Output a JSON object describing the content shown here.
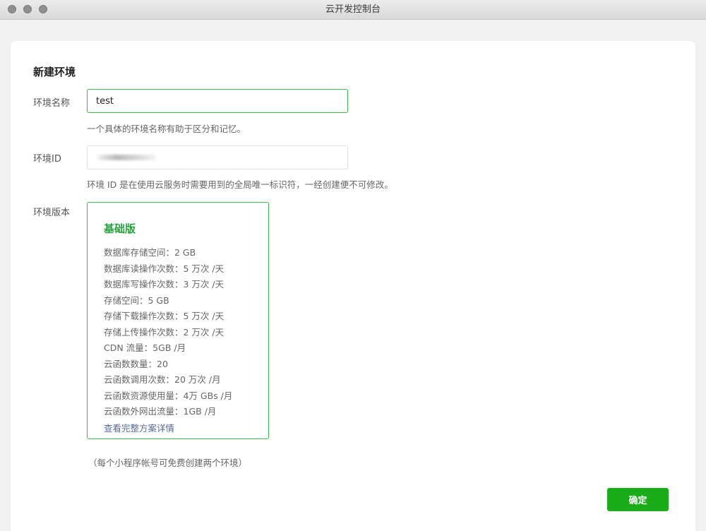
{
  "window": {
    "title": "云开发控制台"
  },
  "form": {
    "heading": "新建环境",
    "env_name": {
      "label": "环境名称",
      "value": "test",
      "hint": "一个具体的环境名称有助于区分和记忆。"
    },
    "env_id": {
      "label": "环境ID",
      "value": "",
      "hint": "环境 ID 是在使用云服务时需要用到的全局唯一标识符，一经创建便不可修改。"
    },
    "env_version": {
      "label": "环境版本",
      "plan": {
        "name": "基础版",
        "features": [
          "数据库存储空间：2 GB",
          "数据库读操作次数：5 万次 /天",
          "数据库写操作次数：3 万次 /天",
          "存储空间：5 GB",
          "存储下载操作次数：5 万次 /天",
          "存储上传操作次数：2 万次 /天",
          "CDN 流量：5GB /月",
          "云函数数量：20",
          "云函数调用次数：20 万次 /月",
          "云函数资源使用量：4万 GBs /月",
          "云函数外网出流量：1GB /月"
        ],
        "details_link": "查看完整方案详情"
      }
    },
    "note": "（每个小程序帐号可免费创建两个环境）",
    "confirm_label": "确定"
  },
  "colors": {
    "accent_green": "#3bb54a",
    "button_green": "#1aad19",
    "link": "#576b95"
  }
}
